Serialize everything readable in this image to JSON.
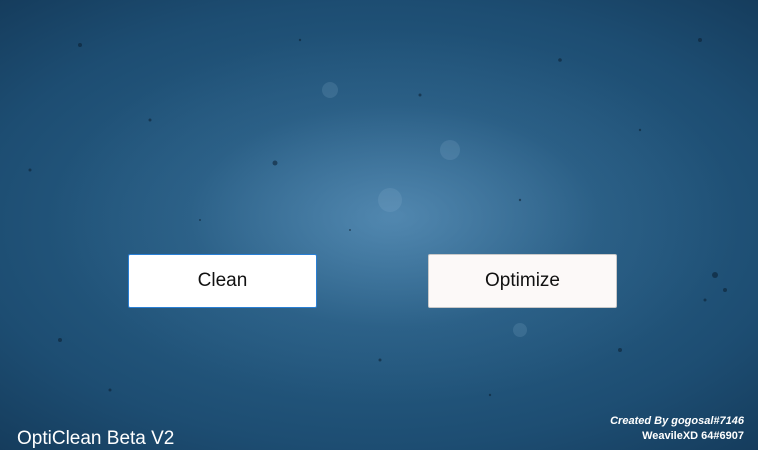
{
  "app": {
    "title": "OptiClean Beta V2"
  },
  "buttons": {
    "clean_label": "Clean",
    "optimize_label": "Optimize"
  },
  "credits": {
    "line1": "Created By gogosal#7146",
    "line2": "WeavileXD 64#6907"
  },
  "colors": {
    "background_center": "#2f6a92",
    "background_edge": "#061a2e",
    "button_bg": "#ffffff",
    "focus_border": "#2a7fd4",
    "text_light": "#ffffff"
  }
}
